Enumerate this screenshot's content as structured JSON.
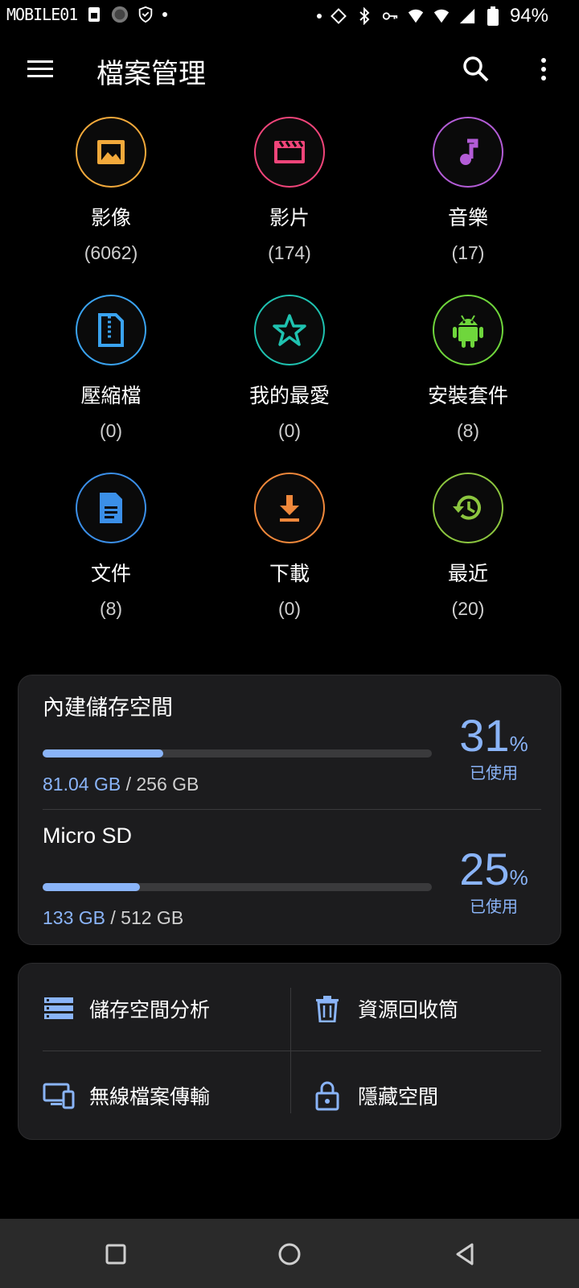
{
  "status_bar": {
    "brand": "MOBILE01",
    "battery_percent": "94%",
    "icons": [
      "sim-icon",
      "shield-icon",
      "rotate-icon",
      "bluetooth-icon",
      "vpn-key-icon",
      "wifi-icon",
      "signal-icon",
      "battery-icon"
    ]
  },
  "app_bar": {
    "title": "檔案管理",
    "menu_icon": "hamburger-menu-icon",
    "search_icon": "search-icon",
    "more_icon": "more-vert-icon"
  },
  "categories": [
    {
      "label": "影像",
      "count": "(6062)",
      "icon": "image-icon",
      "color": "#f2a93b"
    },
    {
      "label": "影片",
      "count": "(174)",
      "icon": "video-icon",
      "color": "#f0457a"
    },
    {
      "label": "音樂",
      "count": "(17)",
      "icon": "music-icon",
      "color": "#b35cd6"
    },
    {
      "label": "壓縮檔",
      "count": "(0)",
      "icon": "archive-icon",
      "color": "#3aa3f0"
    },
    {
      "label": "我的最愛",
      "count": "(0)",
      "icon": "star-icon",
      "color": "#1fc2b0"
    },
    {
      "label": "安裝套件",
      "count": "(8)",
      "icon": "android-icon",
      "color": "#6fd63c"
    },
    {
      "label": "文件",
      "count": "(8)",
      "icon": "document-icon",
      "color": "#3b8fe8"
    },
    {
      "label": "下載",
      "count": "(0)",
      "icon": "download-icon",
      "color": "#f0883b"
    },
    {
      "label": "最近",
      "count": "(20)",
      "icon": "history-icon",
      "color": "#8cc63f"
    }
  ],
  "storage": [
    {
      "name": "內建儲存空間",
      "used": "81.04 GB",
      "total": " / 256 GB",
      "percent": "31",
      "percent_sign": "%",
      "used_label": "已使用",
      "fraction": 0.31
    },
    {
      "name": "Micro SD",
      "used": "133 GB",
      "total": " / 512 GB",
      "percent": "25",
      "percent_sign": "%",
      "used_label": "已使用",
      "fraction": 0.25
    }
  ],
  "tools": [
    {
      "label": "儲存空間分析",
      "icon": "storage-analysis-icon"
    },
    {
      "label": "資源回收筒",
      "icon": "trash-icon"
    },
    {
      "label": "無線檔案傳輸",
      "icon": "wireless-transfer-icon"
    },
    {
      "label": "隱藏空間",
      "icon": "lock-icon"
    }
  ],
  "accent_color": "#8ab4f8",
  "nav_bar": {
    "icons": [
      "recents-icon",
      "home-icon",
      "back-icon"
    ]
  }
}
